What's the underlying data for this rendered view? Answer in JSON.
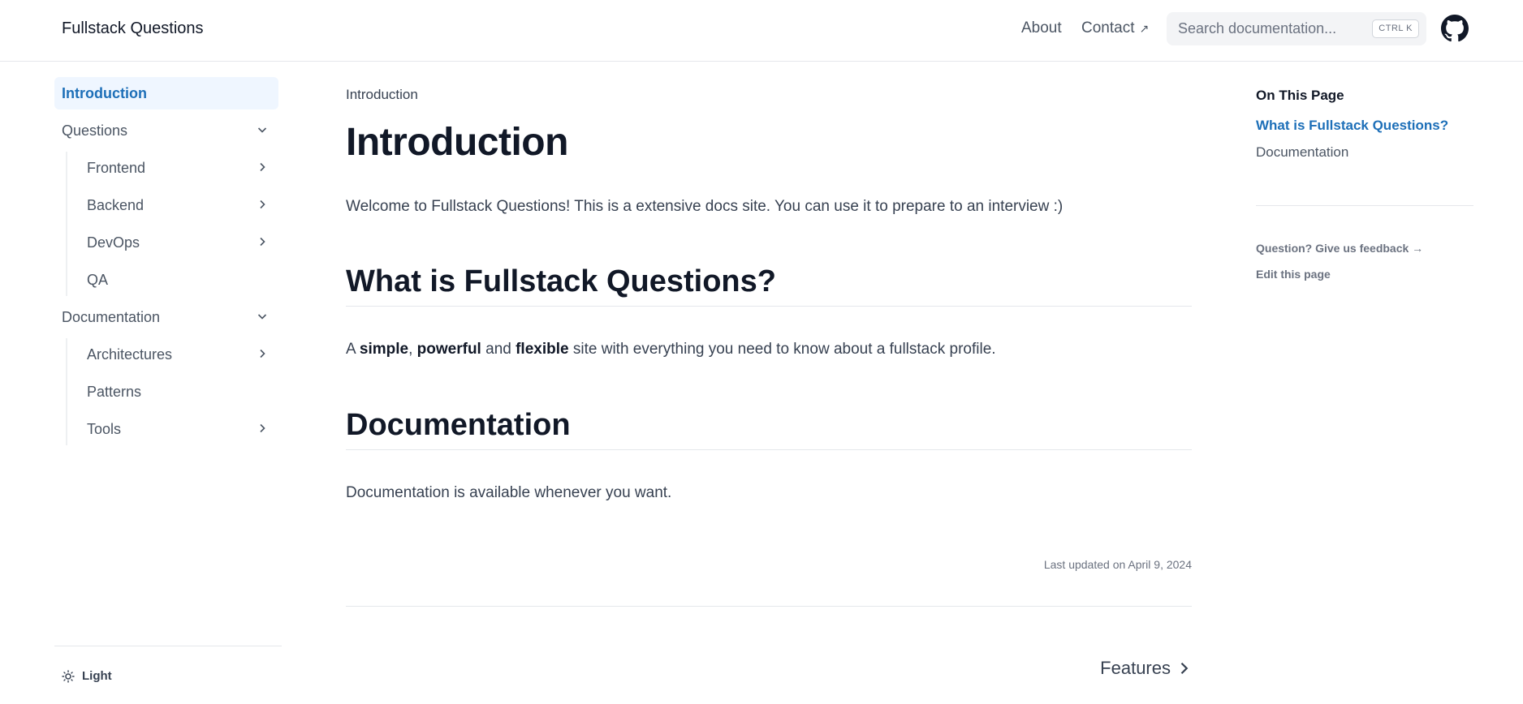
{
  "header": {
    "logo": "Fullstack Questions",
    "nav": [
      {
        "label": "About"
      },
      {
        "label": "Contact",
        "suffix": "↗"
      }
    ],
    "search": {
      "placeholder": "Search documentation...",
      "shortcut": "CTRL K"
    },
    "github_icon": "github-icon"
  },
  "sidebar": {
    "items": [
      {
        "label": "Introduction",
        "active": true
      },
      {
        "label": "Questions",
        "expanded": true,
        "children": [
          {
            "label": "Frontend",
            "has_children": true
          },
          {
            "label": "Backend",
            "has_children": true
          },
          {
            "label": "DevOps",
            "has_children": true
          },
          {
            "label": "QA",
            "has_children": false
          }
        ]
      },
      {
        "label": "Documentation",
        "expanded": true,
        "children": [
          {
            "label": "Architectures",
            "has_children": true
          },
          {
            "label": "Patterns",
            "has_children": false
          },
          {
            "label": "Tools",
            "has_children": true
          }
        ]
      }
    ],
    "theme_label": "Light"
  },
  "main": {
    "breadcrumb": "Introduction",
    "title": "Introduction",
    "intro": "Welcome to Fullstack Questions! This is a extensive docs site. You can use it to prepare to an interview :)",
    "sections": [
      {
        "heading": "What is Fullstack Questions?",
        "body": {
          "a": "A ",
          "b1": "simple",
          "c": ", ",
          "b2": "powerful",
          "d": " and ",
          "b3": "flexible",
          "e": " site with everything you need to know about a fullstack profile."
        }
      },
      {
        "heading": "Documentation",
        "body_text": "Documentation is available whenever you want."
      }
    ],
    "last_updated": "Last updated on April 9, 2024",
    "next_link": "Features"
  },
  "toc": {
    "title": "On This Page",
    "links": [
      {
        "label": "What is Fullstack Questions?",
        "active": true
      },
      {
        "label": "Documentation",
        "active": false
      }
    ],
    "feedback": "Question? Give us feedback →",
    "edit": "Edit this page"
  },
  "colors": {
    "accent": "#1d6fb8",
    "active_bg": "#eff6ff",
    "border": "#e5e7eb",
    "text": "#374151",
    "heading": "#111827"
  }
}
